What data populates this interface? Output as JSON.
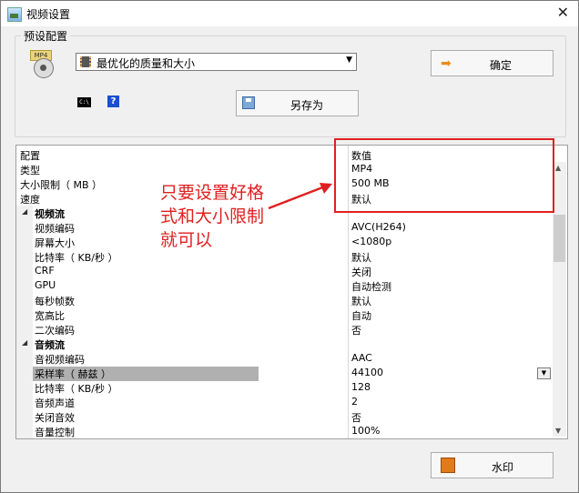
{
  "window": {
    "title": "视频设置",
    "close": "✕"
  },
  "preset": {
    "group_label": "预设配置",
    "mp4_tag": "MP4",
    "selected": "最优化的质量和大小",
    "dropdown_arrow": "▼",
    "ok_label": "确定",
    "cmd_label": "C:\\",
    "help_label": "?",
    "saveas_label": "另存为"
  },
  "grid": {
    "header": {
      "key": "配置",
      "value": "数值"
    },
    "top_rows": [
      {
        "key": "类型",
        "value": "MP4"
      },
      {
        "key": "大小限制（ MB ）",
        "value": "500 MB"
      },
      {
        "key": "速度",
        "value": "默认"
      }
    ],
    "video": {
      "title": "视频流",
      "rows": [
        {
          "key": "视频编码",
          "value": "AVC(H264)"
        },
        {
          "key": "屏幕大小",
          "value": "<1080p"
        },
        {
          "key": "比特率（ KB/秒 ）",
          "value": "默认"
        },
        {
          "key": "CRF",
          "value": "关闭"
        },
        {
          "key": "GPU",
          "value": "自动检测"
        },
        {
          "key": "每秒帧数",
          "value": "默认"
        },
        {
          "key": "宽高比",
          "value": "自动"
        },
        {
          "key": "二次编码",
          "value": "否"
        }
      ]
    },
    "audio": {
      "title": "音频流",
      "rows": [
        {
          "key": "音视频编码",
          "value": "AAC"
        },
        {
          "key": "采样率（ 赫兹 ）",
          "value": "44100"
        },
        {
          "key": "比特率（ KB/秒 ）",
          "value": "128"
        },
        {
          "key": "音频声道",
          "value": "2"
        },
        {
          "key": "关闭音效",
          "value": "否"
        },
        {
          "key": "音量控制",
          "value": "100%"
        }
      ]
    }
  },
  "annotation": {
    "text": "只要设置好格式和大小限制就可以",
    "color": "#e02020"
  },
  "watermark_label": "水印"
}
